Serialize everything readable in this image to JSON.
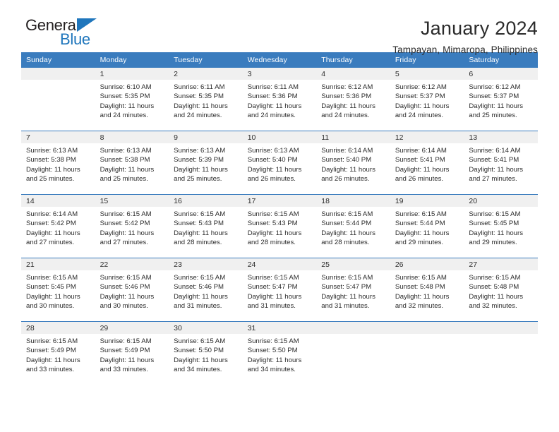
{
  "brand": {
    "name_top": "General",
    "name_bottom": "Blue",
    "accent_color": "#1f76bc"
  },
  "header": {
    "title": "January 2024",
    "subtitle": "Tampayan, Mimaropa, Philippines"
  },
  "calendar": {
    "header_bg": "#3a7cbe",
    "daynum_bg": "#f0f0f0",
    "weekdays": [
      "Sunday",
      "Monday",
      "Tuesday",
      "Wednesday",
      "Thursday",
      "Friday",
      "Saturday"
    ],
    "weeks": [
      [
        {
          "day": "",
          "sunrise": "",
          "sunset": "",
          "daylight1": "",
          "daylight2": ""
        },
        {
          "day": "1",
          "sunrise": "Sunrise: 6:10 AM",
          "sunset": "Sunset: 5:35 PM",
          "daylight1": "Daylight: 11 hours",
          "daylight2": "and 24 minutes."
        },
        {
          "day": "2",
          "sunrise": "Sunrise: 6:11 AM",
          "sunset": "Sunset: 5:35 PM",
          "daylight1": "Daylight: 11 hours",
          "daylight2": "and 24 minutes."
        },
        {
          "day": "3",
          "sunrise": "Sunrise: 6:11 AM",
          "sunset": "Sunset: 5:36 PM",
          "daylight1": "Daylight: 11 hours",
          "daylight2": "and 24 minutes."
        },
        {
          "day": "4",
          "sunrise": "Sunrise: 6:12 AM",
          "sunset": "Sunset: 5:36 PM",
          "daylight1": "Daylight: 11 hours",
          "daylight2": "and 24 minutes."
        },
        {
          "day": "5",
          "sunrise": "Sunrise: 6:12 AM",
          "sunset": "Sunset: 5:37 PM",
          "daylight1": "Daylight: 11 hours",
          "daylight2": "and 24 minutes."
        },
        {
          "day": "6",
          "sunrise": "Sunrise: 6:12 AM",
          "sunset": "Sunset: 5:37 PM",
          "daylight1": "Daylight: 11 hours",
          "daylight2": "and 25 minutes."
        }
      ],
      [
        {
          "day": "7",
          "sunrise": "Sunrise: 6:13 AM",
          "sunset": "Sunset: 5:38 PM",
          "daylight1": "Daylight: 11 hours",
          "daylight2": "and 25 minutes."
        },
        {
          "day": "8",
          "sunrise": "Sunrise: 6:13 AM",
          "sunset": "Sunset: 5:38 PM",
          "daylight1": "Daylight: 11 hours",
          "daylight2": "and 25 minutes."
        },
        {
          "day": "9",
          "sunrise": "Sunrise: 6:13 AM",
          "sunset": "Sunset: 5:39 PM",
          "daylight1": "Daylight: 11 hours",
          "daylight2": "and 25 minutes."
        },
        {
          "day": "10",
          "sunrise": "Sunrise: 6:13 AM",
          "sunset": "Sunset: 5:40 PM",
          "daylight1": "Daylight: 11 hours",
          "daylight2": "and 26 minutes."
        },
        {
          "day": "11",
          "sunrise": "Sunrise: 6:14 AM",
          "sunset": "Sunset: 5:40 PM",
          "daylight1": "Daylight: 11 hours",
          "daylight2": "and 26 minutes."
        },
        {
          "day": "12",
          "sunrise": "Sunrise: 6:14 AM",
          "sunset": "Sunset: 5:41 PM",
          "daylight1": "Daylight: 11 hours",
          "daylight2": "and 26 minutes."
        },
        {
          "day": "13",
          "sunrise": "Sunrise: 6:14 AM",
          "sunset": "Sunset: 5:41 PM",
          "daylight1": "Daylight: 11 hours",
          "daylight2": "and 27 minutes."
        }
      ],
      [
        {
          "day": "14",
          "sunrise": "Sunrise: 6:14 AM",
          "sunset": "Sunset: 5:42 PM",
          "daylight1": "Daylight: 11 hours",
          "daylight2": "and 27 minutes."
        },
        {
          "day": "15",
          "sunrise": "Sunrise: 6:15 AM",
          "sunset": "Sunset: 5:42 PM",
          "daylight1": "Daylight: 11 hours",
          "daylight2": "and 27 minutes."
        },
        {
          "day": "16",
          "sunrise": "Sunrise: 6:15 AM",
          "sunset": "Sunset: 5:43 PM",
          "daylight1": "Daylight: 11 hours",
          "daylight2": "and 28 minutes."
        },
        {
          "day": "17",
          "sunrise": "Sunrise: 6:15 AM",
          "sunset": "Sunset: 5:43 PM",
          "daylight1": "Daylight: 11 hours",
          "daylight2": "and 28 minutes."
        },
        {
          "day": "18",
          "sunrise": "Sunrise: 6:15 AM",
          "sunset": "Sunset: 5:44 PM",
          "daylight1": "Daylight: 11 hours",
          "daylight2": "and 28 minutes."
        },
        {
          "day": "19",
          "sunrise": "Sunrise: 6:15 AM",
          "sunset": "Sunset: 5:44 PM",
          "daylight1": "Daylight: 11 hours",
          "daylight2": "and 29 minutes."
        },
        {
          "day": "20",
          "sunrise": "Sunrise: 6:15 AM",
          "sunset": "Sunset: 5:45 PM",
          "daylight1": "Daylight: 11 hours",
          "daylight2": "and 29 minutes."
        }
      ],
      [
        {
          "day": "21",
          "sunrise": "Sunrise: 6:15 AM",
          "sunset": "Sunset: 5:45 PM",
          "daylight1": "Daylight: 11 hours",
          "daylight2": "and 30 minutes."
        },
        {
          "day": "22",
          "sunrise": "Sunrise: 6:15 AM",
          "sunset": "Sunset: 5:46 PM",
          "daylight1": "Daylight: 11 hours",
          "daylight2": "and 30 minutes."
        },
        {
          "day": "23",
          "sunrise": "Sunrise: 6:15 AM",
          "sunset": "Sunset: 5:46 PM",
          "daylight1": "Daylight: 11 hours",
          "daylight2": "and 31 minutes."
        },
        {
          "day": "24",
          "sunrise": "Sunrise: 6:15 AM",
          "sunset": "Sunset: 5:47 PM",
          "daylight1": "Daylight: 11 hours",
          "daylight2": "and 31 minutes."
        },
        {
          "day": "25",
          "sunrise": "Sunrise: 6:15 AM",
          "sunset": "Sunset: 5:47 PM",
          "daylight1": "Daylight: 11 hours",
          "daylight2": "and 31 minutes."
        },
        {
          "day": "26",
          "sunrise": "Sunrise: 6:15 AM",
          "sunset": "Sunset: 5:48 PM",
          "daylight1": "Daylight: 11 hours",
          "daylight2": "and 32 minutes."
        },
        {
          "day": "27",
          "sunrise": "Sunrise: 6:15 AM",
          "sunset": "Sunset: 5:48 PM",
          "daylight1": "Daylight: 11 hours",
          "daylight2": "and 32 minutes."
        }
      ],
      [
        {
          "day": "28",
          "sunrise": "Sunrise: 6:15 AM",
          "sunset": "Sunset: 5:49 PM",
          "daylight1": "Daylight: 11 hours",
          "daylight2": "and 33 minutes."
        },
        {
          "day": "29",
          "sunrise": "Sunrise: 6:15 AM",
          "sunset": "Sunset: 5:49 PM",
          "daylight1": "Daylight: 11 hours",
          "daylight2": "and 33 minutes."
        },
        {
          "day": "30",
          "sunrise": "Sunrise: 6:15 AM",
          "sunset": "Sunset: 5:50 PM",
          "daylight1": "Daylight: 11 hours",
          "daylight2": "and 34 minutes."
        },
        {
          "day": "31",
          "sunrise": "Sunrise: 6:15 AM",
          "sunset": "Sunset: 5:50 PM",
          "daylight1": "Daylight: 11 hours",
          "daylight2": "and 34 minutes."
        },
        {
          "day": "",
          "sunrise": "",
          "sunset": "",
          "daylight1": "",
          "daylight2": ""
        },
        {
          "day": "",
          "sunrise": "",
          "sunset": "",
          "daylight1": "",
          "daylight2": ""
        },
        {
          "day": "",
          "sunrise": "",
          "sunset": "",
          "daylight1": "",
          "daylight2": ""
        }
      ]
    ]
  }
}
